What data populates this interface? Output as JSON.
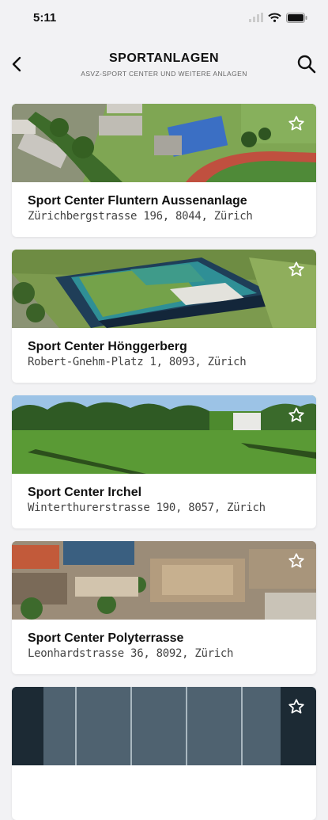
{
  "status": {
    "time": "5:11"
  },
  "header": {
    "title": "SPORTANLAGEN",
    "subtitle": "ASVZ-SPORT CENTER UND WEITERE ANLAGEN"
  },
  "facilities": [
    {
      "name": "Sport Center Fluntern Aussenanlage",
      "address": "Zürichbergstrasse 196, 8044, Zürich"
    },
    {
      "name": "Sport Center Hönggerberg",
      "address": "Robert-Gnehm-Platz 1, 8093, Zürich"
    },
    {
      "name": "Sport Center Irchel",
      "address": "Winterthurerstrasse 190, 8057, Zürich"
    },
    {
      "name": "Sport Center Polyterrasse",
      "address": "Leonhardstrasse 36, 8092, Zürich"
    }
  ],
  "icons": {
    "back": "chevron-left-icon",
    "search": "search-icon",
    "favorite": "star-outline-icon"
  }
}
